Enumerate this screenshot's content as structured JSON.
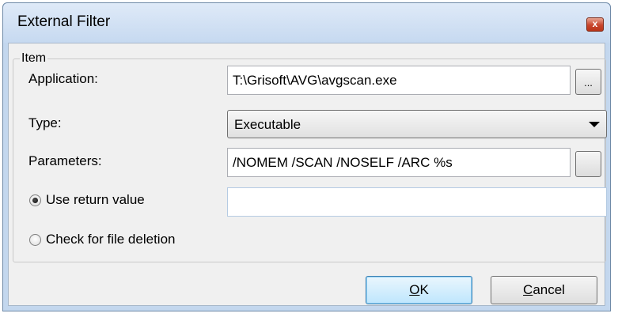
{
  "window": {
    "title": "External Filter",
    "close_glyph": "x"
  },
  "group": {
    "legend": "Item"
  },
  "application": {
    "label": "Application:",
    "value": "T:\\Grisoft\\AVG\\avgscan.exe",
    "browse_label": "..."
  },
  "type": {
    "label": "Type:",
    "value": "Executable"
  },
  "parameters": {
    "label": "Parameters:",
    "value": "/NOMEM /SCAN /NOSELF /ARC %s",
    "browse_label": ""
  },
  "options": {
    "use_return_value": {
      "label": "Use return value",
      "checked": true,
      "field_value": ""
    },
    "check_file_deletion": {
      "label": "Check for file deletion",
      "checked": false
    }
  },
  "buttons": {
    "ok": {
      "mnemonic": "O",
      "rest": "K"
    },
    "cancel": {
      "mnemonic": "C",
      "rest": "ancel"
    }
  },
  "colors": {
    "title_bar": "#c6d9f0",
    "client": "#f0f0f0",
    "close": "#c8452c"
  }
}
